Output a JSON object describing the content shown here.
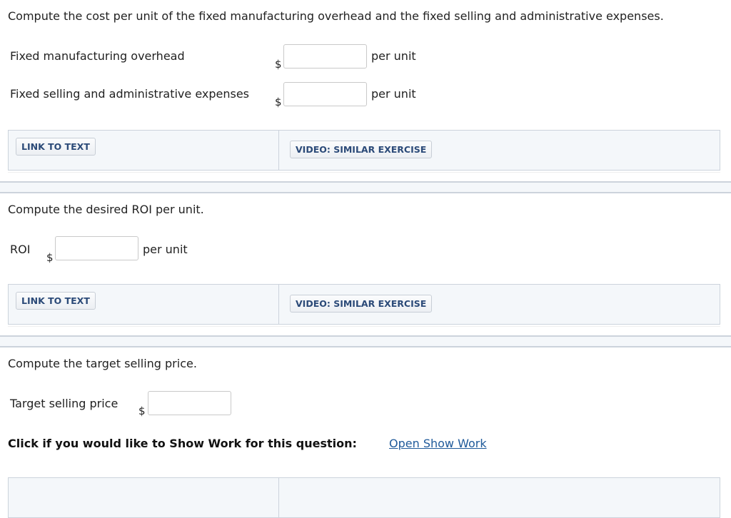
{
  "section1": {
    "question": "Compute the cost per unit of the fixed manufacturing overhead and the fixed selling and administrative expenses.",
    "rows": [
      {
        "label": "Fixed manufacturing overhead",
        "currency": "$",
        "value": "",
        "unit": "per unit"
      },
      {
        "label": "Fixed selling and administrative expenses",
        "currency": "$",
        "value": "",
        "unit": "per unit"
      }
    ],
    "link_to_text": "LINK TO TEXT",
    "video": "VIDEO: SIMILAR EXERCISE"
  },
  "section2": {
    "question": "Compute the desired ROI per unit.",
    "row": {
      "label": "ROI",
      "currency": "$",
      "value": "",
      "unit": "per unit"
    },
    "link_to_text": "LINK TO TEXT",
    "video": "VIDEO: SIMILAR EXERCISE"
  },
  "section3": {
    "question": "Compute the target selling price.",
    "row": {
      "label": "Target selling price",
      "currency": "$",
      "value": ""
    },
    "show_work_prompt": "Click if you would like to Show Work for this question:",
    "show_work_link": "Open Show Work"
  }
}
